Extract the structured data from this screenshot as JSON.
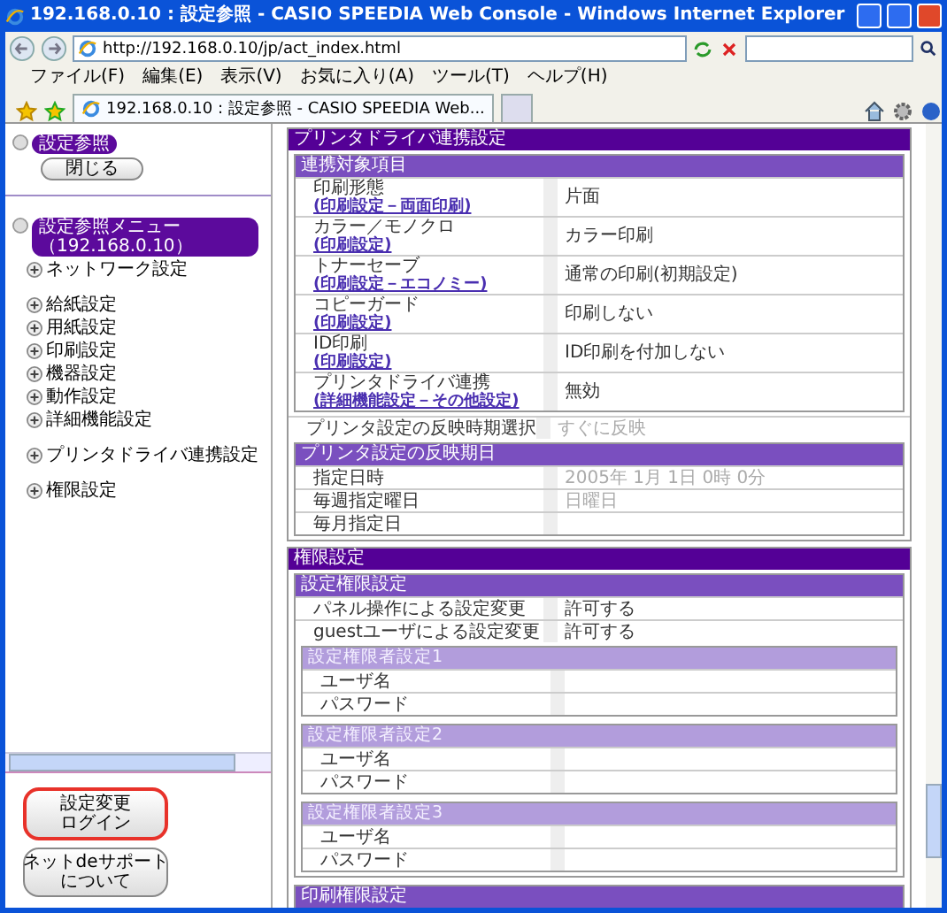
{
  "window": {
    "title": "192.168.0.10 : 設定参照 - CASIO SPEEDIA Web Console - Windows Internet Explorer"
  },
  "address_bar": {
    "url": "http://192.168.0.10/jp/act_index.html"
  },
  "menu": [
    "ファイル(F)",
    "編集(E)",
    "表示(V)",
    "お気に入り(A)",
    "ツール(T)",
    "ヘルプ(H)"
  ],
  "tabs": [
    {
      "label": "192.168.0.10 : 設定参照 - CASIO SPEEDIA Web...",
      "selected": true
    }
  ],
  "sidebar": {
    "header": "設定参照",
    "close_button": "閉じる",
    "menu_title": "設定参照メニュー（192.168.0.10）",
    "item_groups": [
      [
        "ネットワーク設定"
      ],
      [
        "給紙設定",
        "用紙設定",
        "印刷設定",
        "機器設定",
        "動作設定",
        "詳細機能設定"
      ],
      [
        "プリンタドライバ連携設定"
      ],
      [
        "権限設定"
      ]
    ],
    "buttons": [
      {
        "lines": [
          "設定変更",
          "ログイン"
        ],
        "highlighted": true
      },
      {
        "lines": [
          "ネットdeサポート",
          "について"
        ],
        "highlighted": false
      }
    ]
  },
  "sections": [
    {
      "title": "プリンタドライバ連携設定",
      "blocks": [
        {
          "kind": "group",
          "title": "連携対象項目",
          "rows": [
            {
              "label": "印刷形態",
              "link": "(印刷設定－両面印刷)",
              "value": "片面",
              "disabled": false
            },
            {
              "label": "カラー／モノクロ",
              "link": "(印刷設定)",
              "value": "カラー印刷",
              "disabled": false
            },
            {
              "label": "トナーセーブ",
              "link": "(印刷設定－エコノミー)",
              "value": "通常の印刷(初期設定)",
              "disabled": false
            },
            {
              "label": "コピーガード",
              "link": "(印刷設定)",
              "value": "印刷しない",
              "disabled": false
            },
            {
              "label": "ID印刷",
              "link": "(印刷設定)",
              "value": "ID印刷を付加しない",
              "disabled": false
            },
            {
              "label": "プリンタドライバ連携",
              "link": "(詳細機能設定－その他設定)",
              "value": "無効",
              "disabled": false
            }
          ]
        },
        {
          "kind": "row",
          "label": "プリンタ設定の反映時期選択",
          "value": "すぐに反映",
          "disabled": true
        },
        {
          "kind": "group",
          "title": "プリンタ設定の反映期日",
          "rows": [
            {
              "label": "指定日時",
              "value": "2005年 1月 1日 0時 0分",
              "disabled": true
            },
            {
              "label": "毎週指定曜日",
              "value": "日曜日",
              "disabled": true
            },
            {
              "label": "毎月指定日"
            }
          ]
        }
      ]
    },
    {
      "title": "権限設定",
      "blocks": [
        {
          "kind": "group",
          "title": "設定権限設定",
          "rows": [
            {
              "label": "パネル操作による設定変更",
              "value": "許可する",
              "disabled": false
            },
            {
              "label": "guestユーザによる設定変更",
              "value": "許可する",
              "disabled": false
            }
          ],
          "subgroups": [
            {
              "title": "設定権限者設定1",
              "rows": [
                {
                  "label": "ユーザ名"
                },
                {
                  "label": "パスワード"
                }
              ]
            },
            {
              "title": "設定権限者設定2",
              "rows": [
                {
                  "label": "ユーザ名"
                },
                {
                  "label": "パスワード"
                }
              ]
            },
            {
              "title": "設定権限者設定3",
              "rows": [
                {
                  "label": "ユーザ名"
                },
                {
                  "label": "パスワード"
                }
              ]
            }
          ]
        },
        {
          "kind": "group",
          "title": "印刷権限設定"
        }
      ]
    }
  ]
}
